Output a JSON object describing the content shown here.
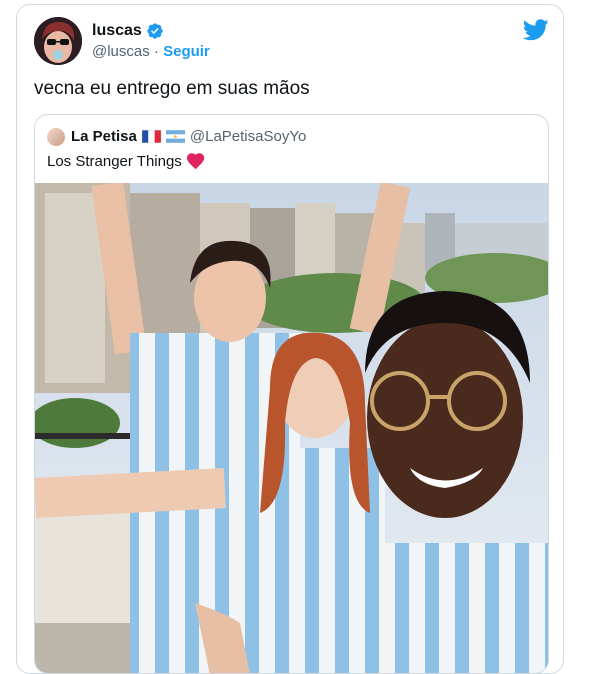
{
  "tweet": {
    "display_name": "luscas",
    "handle": "@luscas",
    "separator": " · ",
    "follow_label": "Seguir",
    "text": "vecna eu entrego em suas mãos"
  },
  "quote": {
    "display_name": "La Petisa",
    "handle": "@LaPetisaSoyYo",
    "text": "Los Stranger Things"
  },
  "colors": {
    "accent": "#1d9bf0",
    "secondary_text": "#536471",
    "border": "#cfd9de",
    "heart": "#f91880"
  },
  "icons": [
    "verified-badge-icon",
    "twitter-bird-icon",
    "france-flag-icon",
    "argentina-flag-icon",
    "red-heart-icon"
  ]
}
